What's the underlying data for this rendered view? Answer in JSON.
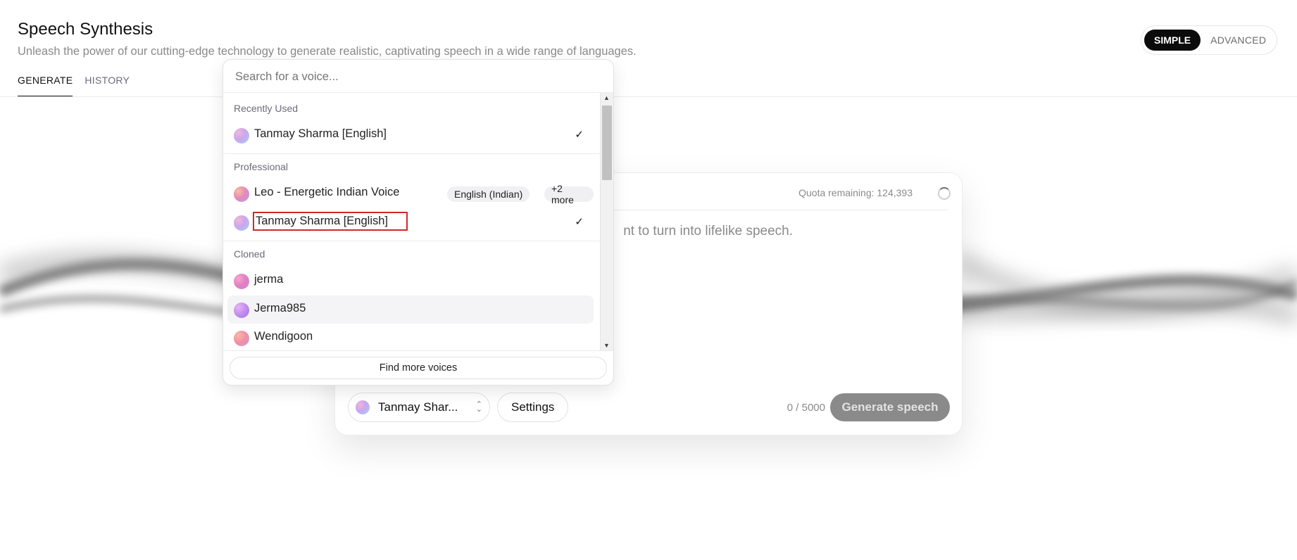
{
  "header": {
    "title": "Speech Synthesis",
    "subtitle": "Unleash the power of our cutting-edge technology to generate realistic, captivating speech in a wide range of languages.",
    "tabs": [
      {
        "label": "GENERATE",
        "active": true
      },
      {
        "label": "HISTORY",
        "active": false
      }
    ]
  },
  "mode_toggle": {
    "simple": "SIMPLE",
    "advanced": "ADVANCED",
    "selected": "SIMPLE"
  },
  "card": {
    "quota": "Quota remaining: 124,393",
    "prompt_placeholder_visible": "nt to turn into lifelike speech.",
    "voice_select_label": "Tanmay Shar...",
    "settings_label": "Settings",
    "char_count": "0 / 5000",
    "generate_label": "Generate speech"
  },
  "dropdown": {
    "search_placeholder": "Search for a voice...",
    "sections": {
      "recent": "Recently Used",
      "professional": "Professional",
      "cloned": "Cloned"
    },
    "recent_items": [
      {
        "label": "Tanmay Sharma [English]",
        "checked": true
      }
    ],
    "professional_items": [
      {
        "label": "Leo - Energetic Indian Voice",
        "badges": [
          "English (Indian)",
          "+2 more"
        ]
      },
      {
        "label": "Tanmay Sharma [English]",
        "checked": true,
        "highlighted_box": true
      }
    ],
    "cloned_items": [
      {
        "label": "jerma"
      },
      {
        "label": "Jerma985",
        "hover": true
      },
      {
        "label": "Wendigoon"
      }
    ],
    "find_more_label": "Find more voices",
    "check_glyph": "✓"
  },
  "icons": {
    "scroll_up": "▲",
    "scroll_down": "▼",
    "sort": [
      "⌃",
      "⌄"
    ]
  },
  "colors": {
    "accent_dark": "#0b0b0b",
    "generate_disabled": "#8a8a8a",
    "highlight_border": "#d32828"
  }
}
